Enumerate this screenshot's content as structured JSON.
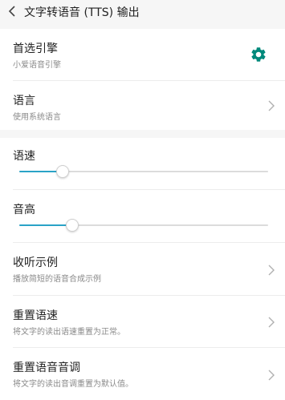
{
  "header": {
    "title": "文字转语音 (TTS) 输出"
  },
  "engine": {
    "title": "首选引擎",
    "subtitle": "小爱语音引擎"
  },
  "language": {
    "title": "语言",
    "subtitle": "使用系统语言"
  },
  "speech_rate": {
    "label": "语速",
    "value": 0.17
  },
  "pitch": {
    "label": "音高",
    "value": 0.21
  },
  "listen_example": {
    "title": "收听示例",
    "subtitle": "播放简短的语音合成示例"
  },
  "reset_rate": {
    "title": "重置语速",
    "subtitle": "将文字的读出语速重置为正常。"
  },
  "reset_pitch": {
    "title": "重置语音音调",
    "subtitle": "将文字的读出音调重置为默认值。"
  },
  "colors": {
    "accent": "#2aa3c7",
    "gear": "#00897b"
  }
}
